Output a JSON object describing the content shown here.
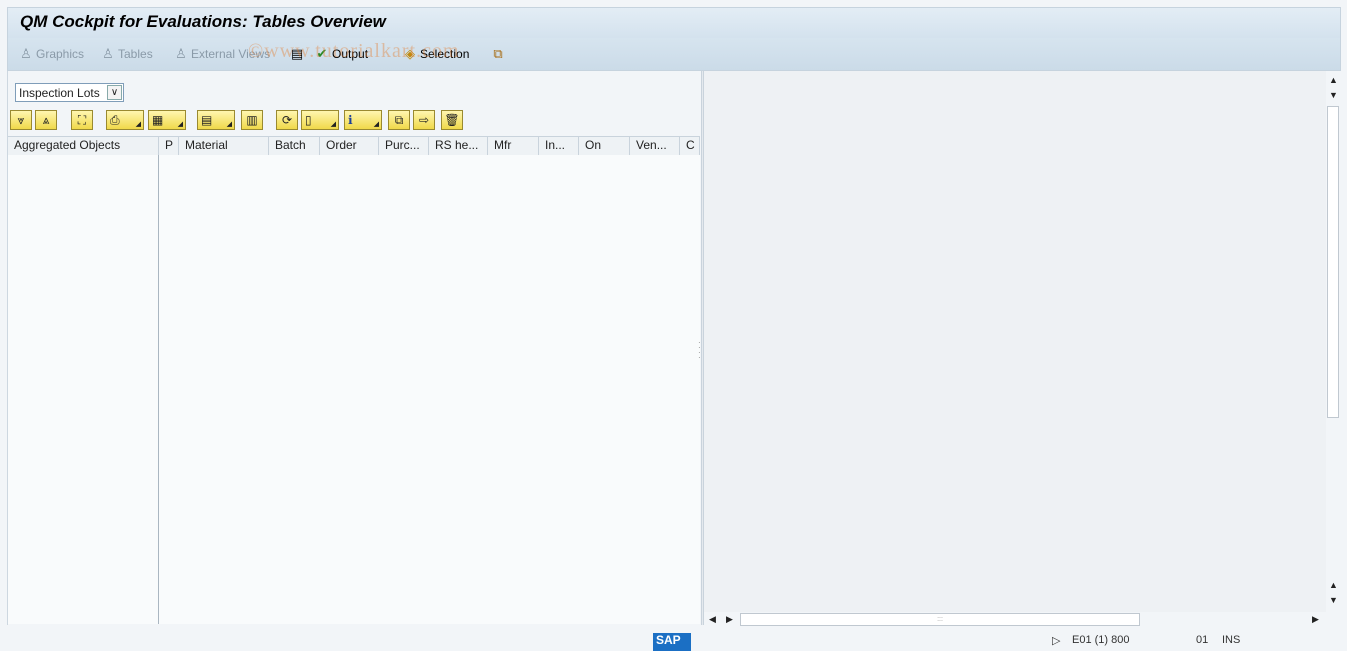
{
  "window": {
    "title": "QM Cockpit for Evaluations: Tables Overview"
  },
  "toolbar": {
    "graphics": "Graphics",
    "tables": "Tables",
    "external_views": "External Views",
    "output": "Output",
    "selection": "Selection"
  },
  "watermark": "©www.tutorialkart.com",
  "object_select": {
    "value": "Inspection Lots"
  },
  "grid": {
    "tree_header": "Aggregated Objects",
    "columns": [
      "P",
      "Material",
      "Batch",
      "Order",
      "Purc...",
      "RS he...",
      "Mfr",
      "In...",
      "On",
      "Ven...",
      "C"
    ]
  },
  "status": {
    "logo": "SAP",
    "system": "E01 (1) 800",
    "server": "01",
    "mode": "INS"
  },
  "colors": {
    "accent": "#f0d94a",
    "title_bg": "#d4e2ee"
  }
}
